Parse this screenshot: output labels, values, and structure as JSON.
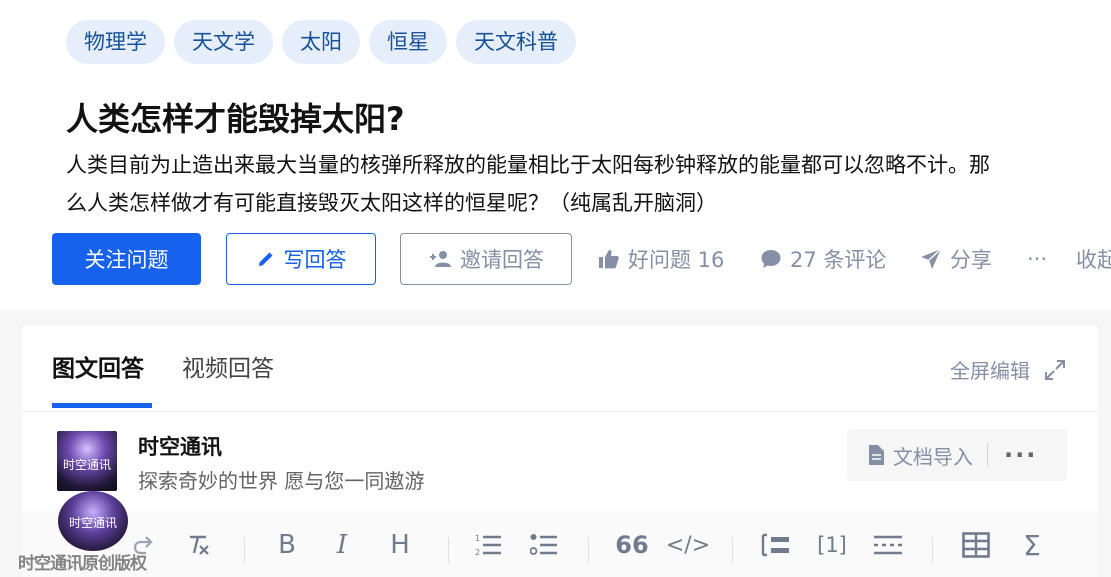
{
  "question": {
    "tags": [
      "物理学",
      "天文学",
      "太阳",
      "恒星",
      "天文科普"
    ],
    "title": "人类怎样才能毁掉太阳?",
    "detail_line1": "人类目前为止造出来最大当量的核弹所释放的能量相比于太阳每秒钟释放的能量都可以忽略不计。那",
    "detail_line2": "么人类怎样做才有可能直接毁灭太阳这样的恒星呢？（纯属乱开脑洞）"
  },
  "actions": {
    "follow_label": "关注问题",
    "write_label": "写回答",
    "invite_label": "邀请回答",
    "upvote_label": "好问题 16",
    "comments_label": "27 条评论",
    "share_label": "分享",
    "more_label": "···",
    "collapse_label": "收起"
  },
  "editor": {
    "tab_active": "图文回答",
    "tab_inactive": "视频回答",
    "fullscreen_label": "全屏编辑",
    "author_name": "时空通讯",
    "author_bio": "探索奇妙的世界 愿与您一同遨游",
    "avatar_text": "时空通讯",
    "import_label": "文档导入",
    "more_label": "···",
    "toolbar": {
      "bold": "B",
      "italic": "I",
      "heading": "H",
      "quote": "66",
      "code": "</>",
      "footnote": "[1]",
      "formula": "Σ"
    }
  },
  "watermark": {
    "text": "时空通讯原创版权",
    "logo_text": "时空通讯"
  },
  "colors": {
    "primary": "#1662ef",
    "tag_bg": "#e6eefc",
    "tag_text": "#175199",
    "muted": "#8590a6"
  }
}
